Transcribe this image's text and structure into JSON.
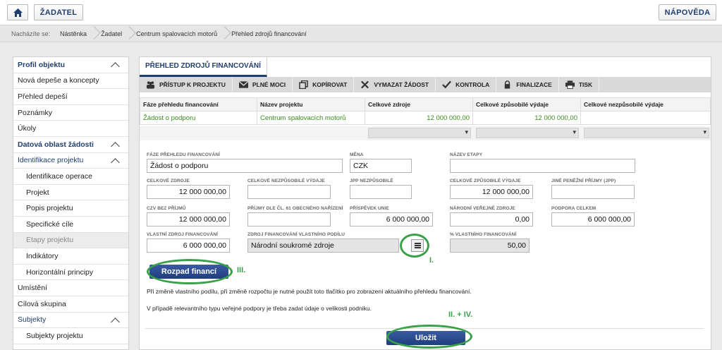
{
  "topbar": {
    "home_label": "",
    "zadatel_label": "ŽADATEL",
    "napoveda_label": "NÁPOVĚDA"
  },
  "breadcrumb": {
    "prefix": "Nacházíte se:",
    "items": [
      "Nástěnka",
      "Žadatel",
      "Centrum spalovacích motorů",
      "Přehled zdrojů financování"
    ]
  },
  "sidebar": {
    "items": [
      {
        "label": "Profil objektu"
      },
      {
        "label": "Nová depeše a koncepty"
      },
      {
        "label": "Přehled depeší"
      },
      {
        "label": "Poznámky"
      },
      {
        "label": "Úkoly"
      },
      {
        "label": "Datová oblast žádosti"
      },
      {
        "label": "Identifikace projektu"
      },
      {
        "label": "Identifikace operace"
      },
      {
        "label": "Projekt"
      },
      {
        "label": "Popis projektu"
      },
      {
        "label": "Specifické cíle"
      },
      {
        "label": "Etapy projektu"
      },
      {
        "label": "Indikátory"
      },
      {
        "label": "Horizontální principy"
      },
      {
        "label": "Umístění"
      },
      {
        "label": "Cílová skupina"
      },
      {
        "label": "Subjekty"
      },
      {
        "label": "Subjekty projektu"
      }
    ]
  },
  "tab": {
    "title": "PŘEHLED ZDROJŮ FINANCOVÁNÍ"
  },
  "toolbar": {
    "items": [
      {
        "label": "PŘÍSTUP K PROJEKTU",
        "icon": "users-icon"
      },
      {
        "label": "PLNÉ MOCI",
        "icon": "envelope-icon"
      },
      {
        "label": "KOPÍROVAT",
        "icon": "copy-icon"
      },
      {
        "label": "VYMAZAT ŽÁDOST",
        "icon": "close-icon"
      },
      {
        "label": "KONTROLA",
        "icon": "check-icon"
      },
      {
        "label": "FINALIZACE",
        "icon": "lock-icon"
      },
      {
        "label": "TISK",
        "icon": "printer-icon"
      }
    ]
  },
  "grid": {
    "headers": [
      "Fáze přehledu financování",
      "Název projektu",
      "Celkové zdroje",
      "Celkové způsobilé výdaje",
      "Celkové nezpůsobilé výdaje"
    ],
    "row": [
      "Žádost o podporu",
      "Centrum spalovacích motorů",
      "12 000 000,00",
      "12 000 000,00",
      ""
    ]
  },
  "form": {
    "faze_label": "FÁZE PŘEHLEDU FINANCOVÁNÍ",
    "faze_value": "Žádost o podporu",
    "mena_label": "MĚNA",
    "mena_value": "CZK",
    "nazev_etapy_label": "NÁZEV ETAPY",
    "nazev_etapy_value": "",
    "celkove_zdroje_label": "CELKOVÉ ZDROJE",
    "celkove_zdroje_value": "12 000 000,00",
    "celk_nezpus_label": "CELKOVÉ NEZPŮSOBILÉ VÝDAJE",
    "celk_nezpus_value": "",
    "jpp_nezpus_label": "JPP NEZPŮSOBILÉ",
    "jpp_nezpus_value": "",
    "celk_zpus_label": "CELKOVÉ ZPŮSOBILÉ VÝDAJE",
    "celk_zpus_value": "12 000 000,00",
    "jine_prijmy_label": "JINÉ PENĚŽNÍ PŘÍJMY (JPP)",
    "jine_prijmy_value": "",
    "czv_label": "CZV BEZ PŘÍJMŮ",
    "czv_value": "12 000 000,00",
    "prijmy61_label": "PŘÍJMY DLE ČL. 61 OBECNÉHO NAŘÍZENÍ",
    "prijmy61_value": "",
    "prispevek_label": "PŘÍSPĚVEK UNIE",
    "prispevek_value": "6 000 000,00",
    "narodni_label": "NÁRODNÍ VEŘEJNÉ ZDROJE",
    "narodni_value": "0,00",
    "podpora_label": "PODPORA CELKEM",
    "podpora_value": "6 000 000,00",
    "vlastni_label": "VLASTNÍ ZDROJ FINANCOVÁNÍ",
    "vlastni_value": "6 000 000,00",
    "zdroj_vp_label": "ZDROJ FINANCOVÁNÍ VLASTNÍHO PODÍLU",
    "zdroj_vp_value": "Národní soukromé zdroje",
    "pct_label": "% VLASTNÍHO FINANCOVÁNÍ",
    "pct_value": "50,00"
  },
  "buttons": {
    "rozpad": "Rozpad financí",
    "ulozit": "Uložit"
  },
  "notes": {
    "note1": "Při změně vlastního podílu, při změně rozpočtu je nutné použít toto tlačítko pro zobrazení aktuálního přehledu financování.",
    "note2": "V případě relevantního typu veřejné podpory je třeba zadat údaje o velikosti podniku."
  },
  "annotations": {
    "a1": "I.",
    "a2": "II. + IV.",
    "a3": "III."
  },
  "colors": {
    "accent": "#1f3e6e",
    "annotation": "#3aa14a",
    "grid_value": "#3a8a1a"
  }
}
